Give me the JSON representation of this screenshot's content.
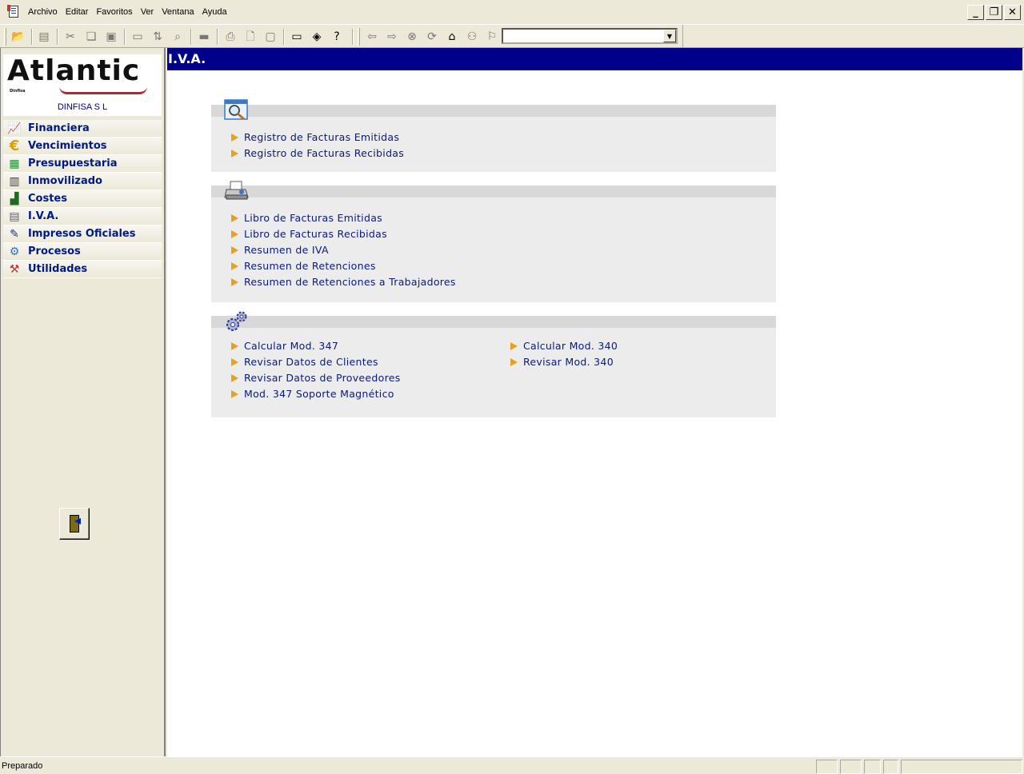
{
  "menubar": {
    "items": [
      "Archivo",
      "Editar",
      "Favoritos",
      "Ver",
      "Ventana",
      "Ayuda"
    ],
    "window_controls": [
      "minimize-icon",
      "restore-icon",
      "close-icon"
    ]
  },
  "toolbar": {
    "icons": [
      "open-folder-icon",
      "properties-icon",
      "cut-icon",
      "copy-icon",
      "paste-icon",
      "window-icon",
      "find-replace-icon",
      "search-icon",
      "scanner-icon",
      "print-icon",
      "print-preview-icon",
      "page-setup-icon",
      "monitor-icon",
      "book-icon",
      "help-icon",
      "back-icon",
      "forward-icon",
      "stop-icon",
      "refresh-icon",
      "home-icon",
      "binoculars-icon",
      "favorite-icon"
    ],
    "address_value": ""
  },
  "sidebar": {
    "logo": "Atlantic",
    "logo_sub": "Dinfisa",
    "company": "DINFISA  S L",
    "items": [
      {
        "label": "Financiera",
        "icon": "chart-icon"
      },
      {
        "label": "Vencimientos",
        "icon": "euro-icon"
      },
      {
        "label": "Presupuestaria",
        "icon": "money-icon"
      },
      {
        "label": "Inmovilizado",
        "icon": "building-icon"
      },
      {
        "label": "Costes",
        "icon": "factory-icon"
      },
      {
        "label": "I.V.A.",
        "icon": "document-icon"
      },
      {
        "label": "Impresos Oficiales",
        "icon": "pen-icon"
      },
      {
        "label": "Procesos",
        "icon": "gears-icon"
      },
      {
        "label": "Utilidades",
        "icon": "tools-icon"
      }
    ],
    "exit_icon": "exit-door-icon"
  },
  "main": {
    "title": "I.V.A.",
    "sections": [
      {
        "icon": "magnifier-window-icon",
        "links": [
          "Registro de Facturas Emitidas",
          "Registro de Facturas Recibidas"
        ]
      },
      {
        "icon": "printer-icon",
        "links": [
          "Libro de Facturas Emitidas",
          "Libro de Facturas Recibidas",
          "Resumen de IVA",
          "Resumen de Retenciones",
          "Resumen de Retenciones a Trabajadores"
        ]
      },
      {
        "icon": "gears-icon",
        "links_left": [
          "Calcular Mod. 347",
          "Revisar Datos de Clientes",
          "Revisar Datos de Proveedores",
          "Mod. 347 Soporte Magnético"
        ],
        "links_right": [
          "Calcular Mod. 340",
          "Revisar Mod. 340"
        ]
      }
    ]
  },
  "statusbar": {
    "text": "Preparado"
  },
  "colors": {
    "header_bg": "#00008b",
    "link_color": "#0a1a78",
    "arrow_color": "#e8a020",
    "nav_label": "#001a80"
  }
}
